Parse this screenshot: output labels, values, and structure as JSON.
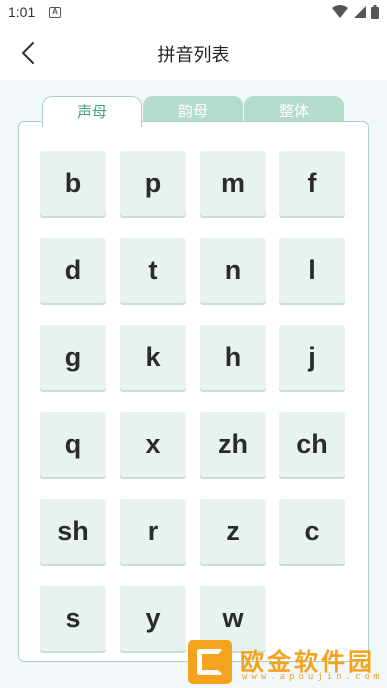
{
  "status_bar": {
    "time": "1:01",
    "badge": "A"
  },
  "header": {
    "title": "拼音列表"
  },
  "tabs": [
    {
      "label": "声母",
      "active": true
    },
    {
      "label": "韵母",
      "active": false
    },
    {
      "label": "整体",
      "active": false
    }
  ],
  "keys": [
    "b",
    "p",
    "m",
    "f",
    "d",
    "t",
    "n",
    "l",
    "g",
    "k",
    "h",
    "j",
    "q",
    "x",
    "zh",
    "ch",
    "sh",
    "r",
    "z",
    "c",
    "s",
    "y",
    "w"
  ],
  "watermark": {
    "brand": "欧金软件园",
    "url": "www.apoujin.com"
  },
  "colors": {
    "accent": "#4aa18a",
    "tab_inactive": "#b3dccd",
    "key_bg": "#e8f3ef",
    "card_border": "#a9d1c7",
    "watermark": "#f3a31d"
  }
}
